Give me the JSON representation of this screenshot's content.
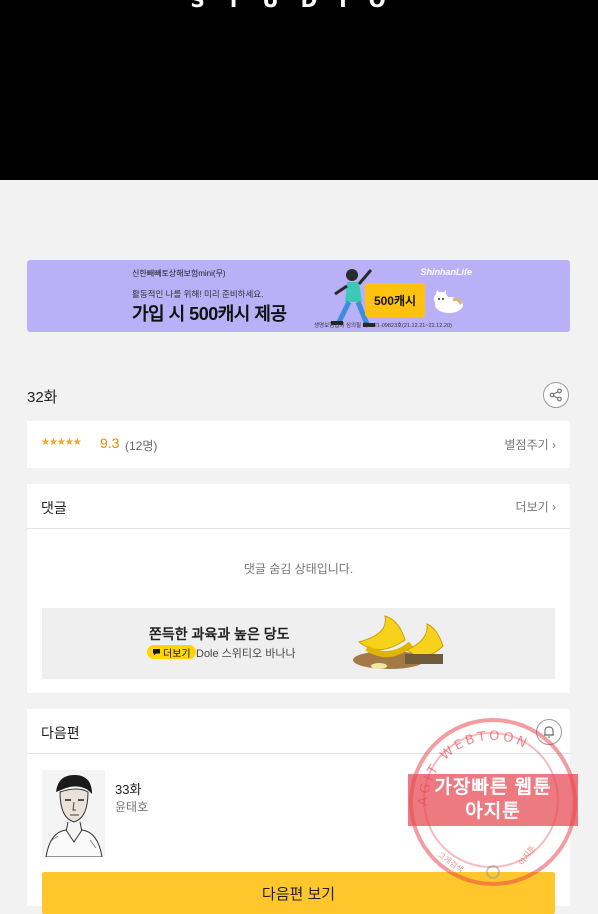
{
  "hero": {
    "logo_text": "STUDIO"
  },
  "ad_banner": {
    "sponsor": "신한빼빼토상해보험mini(무)",
    "subline": "활동적인 나를 위해! 미리 준비하세요.",
    "headline": "가입 시 500캐시 제공",
    "brand": "ShinhanLife",
    "coupon": "500캐시",
    "fine_print": "생명보험협회 심의필 제2021-09823호(21.12.21~22.12.20)"
  },
  "episode": {
    "title": "32화",
    "share_icon": "share-icon"
  },
  "rating": {
    "stars": "★★★★★",
    "score": "9.3",
    "count": "(12명)",
    "rate_link": "별점주기 ›"
  },
  "comments": {
    "title": "댓글",
    "more": "더보기 ›",
    "hidden_msg": "댓글 숨김 상태입니다.",
    "ad": {
      "headline": "쫀득한 과육과 높은 당도",
      "pill": "더보기",
      "brand": "Dole 스위티오 바나나"
    }
  },
  "next": {
    "title": "다음편",
    "episode": "33화",
    "author": "윤태호",
    "button": "다음편 보기",
    "bell_icon": "bell-icon"
  },
  "watermark": {
    "line1": "가장빠른 웹툰",
    "line2": "아지툰",
    "arc_text": "AGIT WEBTOON",
    "bottom_left": "그게검색",
    "bottom_right": "아지툰"
  },
  "colors": {
    "hero_bg": "#000000",
    "ad_bg": "#b9b0f7",
    "accent_yellow": "#ffc72c",
    "star": "#f5a623",
    "watermark_red": "#e83c46"
  }
}
